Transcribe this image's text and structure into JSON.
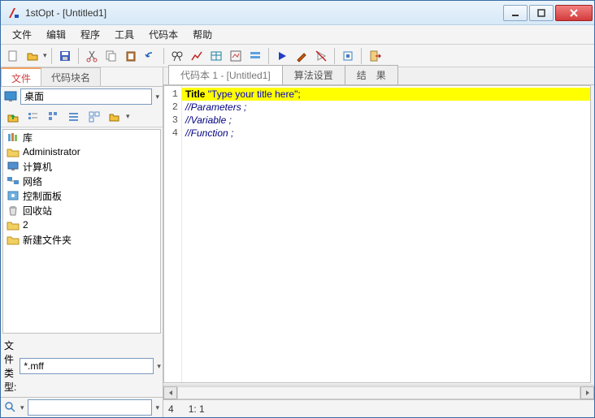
{
  "window": {
    "title": "1stOpt - [Untitled1]"
  },
  "menu": {
    "file": "文件",
    "edit": "编辑",
    "program": "程序",
    "tools": "工具",
    "codebook": "代码本",
    "help": "帮助"
  },
  "sidebar": {
    "tabs": {
      "file": "文件",
      "block": "代码块名"
    },
    "location": "桌面",
    "tree": {
      "library": "库",
      "admin": "Administrator",
      "computer": "计算机",
      "network": "网络",
      "controlpanel": "控制面板",
      "recycle": "回收站",
      "two": "2",
      "newfolder": "新建文件夹"
    },
    "filetype_label": "文件类型:",
    "filetype_value": "*.mff"
  },
  "editor": {
    "tabs": {
      "code": "代码本 1 - [Untitled1]",
      "algo": "算法设置",
      "result": "结　果"
    },
    "lines": {
      "n1": "1",
      "n2": "2",
      "n3": "3",
      "n4": "4",
      "l1_kw": "Title ",
      "l1_str": "\"Type your title here\"",
      "l1_end": ";",
      "l2": "//Parameters ;",
      "l3": "//Variable ;",
      "l4": "//Function ;"
    }
  },
  "status": {
    "line": "4",
    "pos": "1: 1"
  }
}
